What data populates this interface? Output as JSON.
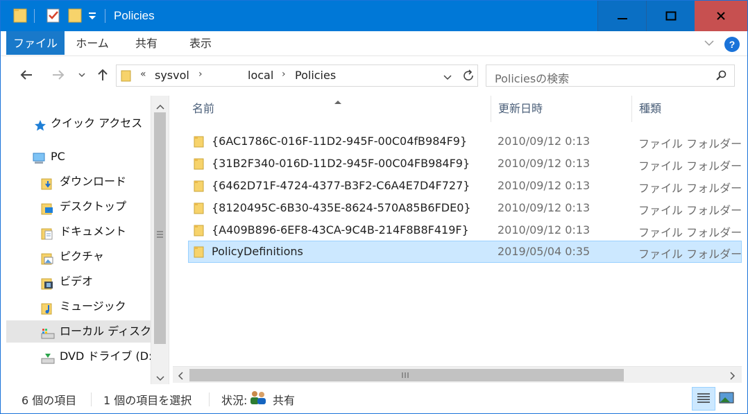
{
  "window": {
    "title": "Policies",
    "accent": "#0078d7"
  },
  "ribbon": {
    "tabs": [
      "ファイル",
      "ホーム",
      "共有",
      "表示"
    ],
    "help": "?"
  },
  "address": {
    "overflow": "«",
    "crumbs": [
      "sysvol",
      "local",
      "Policies"
    ],
    "search_placeholder": "Policiesの検索"
  },
  "nav": {
    "quick_access": "クイック アクセス",
    "pc": "PC",
    "items": [
      "ダウンロード",
      "デスクトップ",
      "ドキュメント",
      "ピクチャ",
      "ビデオ",
      "ミュージック",
      "ローカル ディスク (C",
      "DVD ドライブ (D:)"
    ]
  },
  "columns": [
    "名前",
    "更新日時",
    "種類"
  ],
  "files": [
    {
      "name": "{6AC1786C-016F-11D2-945F-00C04fB984F9}",
      "date": "2010/09/12 0:13",
      "type": "ファイル フォルダー"
    },
    {
      "name": "{31B2F340-016D-11D2-945F-00C04FB984F9}",
      "date": "2010/09/12 0:13",
      "type": "ファイル フォルダー"
    },
    {
      "name": "{6462D71F-4724-4377-B3F2-C6A4E7D4F727}",
      "date": "2010/09/12 0:13",
      "type": "ファイル フォルダー"
    },
    {
      "name": "{8120495C-6B30-435E-8624-570A85B6FDE0}",
      "date": "2010/09/12 0:13",
      "type": "ファイル フォルダー"
    },
    {
      "name": "{A409B896-6EF8-43CA-9C4B-214F8B8F419F}",
      "date": "2010/09/12 0:13",
      "type": "ファイル フォルダー"
    },
    {
      "name": "PolicyDefinitions",
      "date": "2019/05/04 0:35",
      "type": "ファイル フォルダー"
    }
  ],
  "status": {
    "count": "6 個の項目",
    "selected": "1 個の項目を選択",
    "state_label": "状況:",
    "state_value": "共有"
  }
}
